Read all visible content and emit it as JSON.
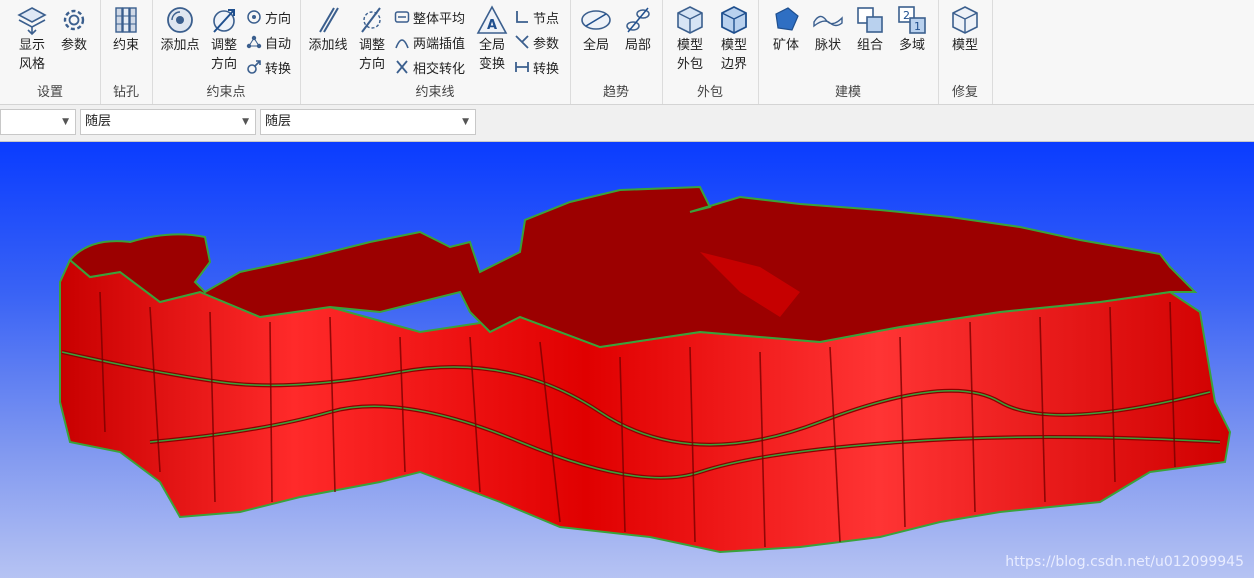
{
  "ribbon": {
    "groups": {
      "settings": {
        "label": "设置",
        "show_grid": "显示\n风格",
        "params": "参数"
      },
      "drill": {
        "label": "钻孔",
        "constraint": "约束"
      },
      "cpoint": {
        "label": "约束点",
        "add_point": "添加点",
        "adjust_dir": "调整\n方向",
        "direction": "方向",
        "auto": "自动",
        "convert": "转换"
      },
      "cline": {
        "label": "约束线",
        "add_line": "添加线",
        "adjust_dir": "调整\n方向",
        "overall_avg": "整体平均",
        "two_end_interp": "两端插值",
        "intersect_conv": "相交转化",
        "global_transform": "全局\n变换",
        "node": "节点",
        "param": "参数",
        "convert": "转换"
      },
      "trend": {
        "label": "趋势",
        "global": "全局",
        "local": "局部"
      },
      "envelope": {
        "label": "外包",
        "model_env": "模型\n外包",
        "model_boundary": "模型\n边界"
      },
      "modeling": {
        "label": "建模",
        "orebody": "矿体",
        "vein": "脉状",
        "combine": "组合",
        "multidomain": "多域"
      },
      "repair": {
        "label": "修复",
        "model": "模型"
      }
    }
  },
  "toolbar": {
    "combo1": "",
    "combo2": "随层",
    "combo3": "随层"
  },
  "watermark": "https://blog.csdn.net/u012099945",
  "colors": {
    "model_red": "#e00000",
    "model_top": "#9c0000",
    "edge_green": "#3aa23a",
    "bg_top": "#0a3cff",
    "bg_bottom": "#b6c3f3"
  }
}
